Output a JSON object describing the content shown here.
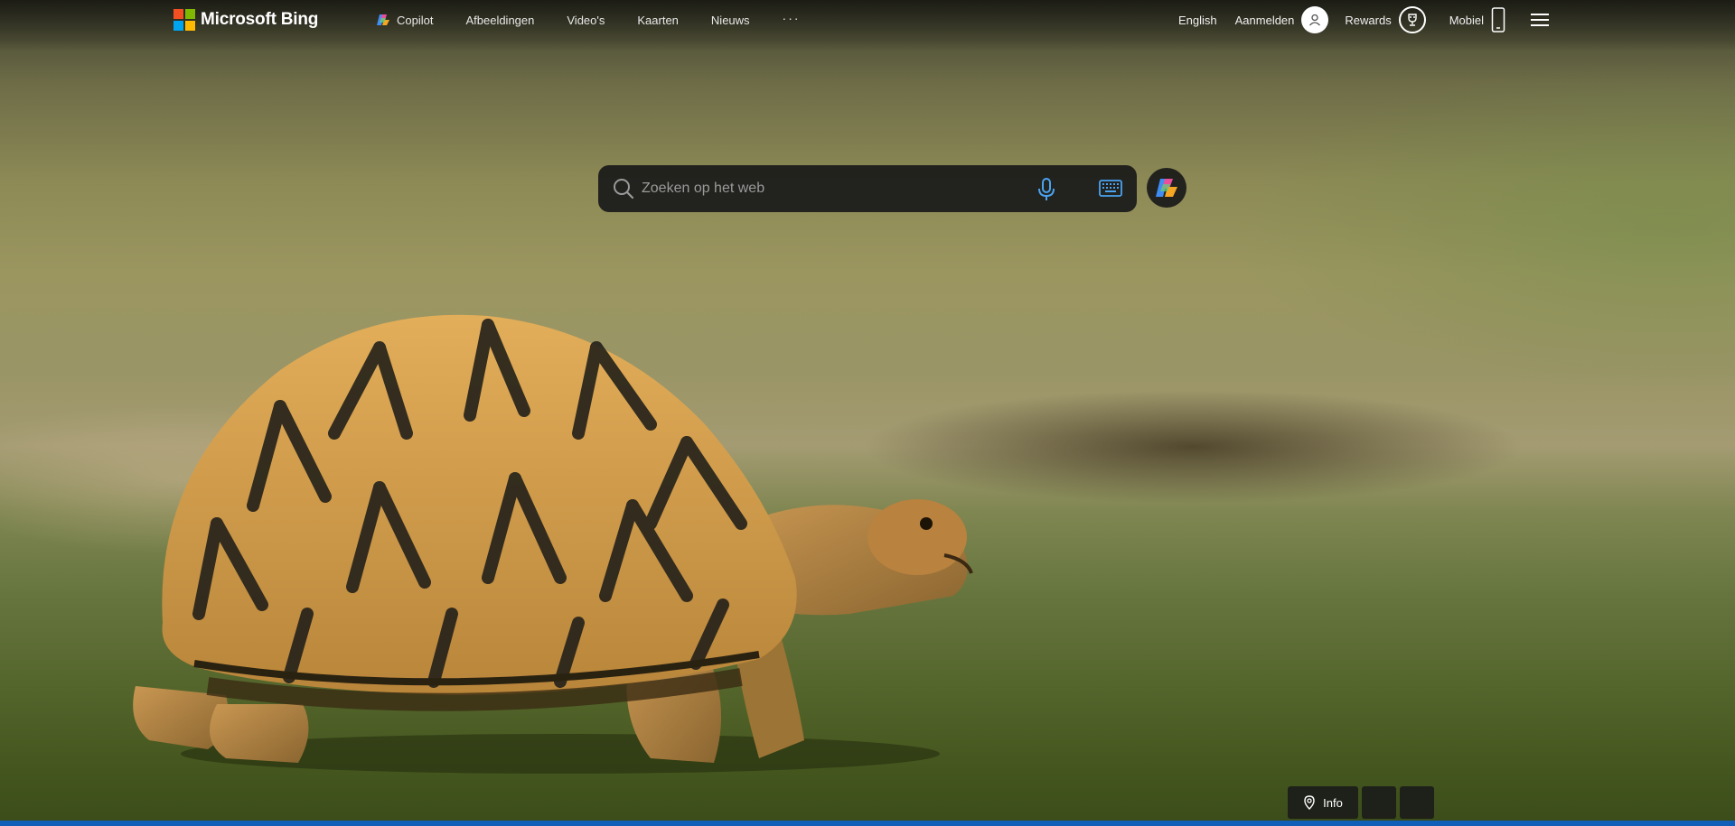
{
  "header": {
    "logo_text": "Microsoft Bing",
    "nav": [
      {
        "label": "Copilot"
      },
      {
        "label": "Afbeeldingen"
      },
      {
        "label": "Video's"
      },
      {
        "label": "Kaarten"
      },
      {
        "label": "Nieuws"
      }
    ],
    "more_label": "···",
    "language_label": "English",
    "signin_label": "Aanmelden",
    "rewards_label": "Rewards",
    "mobile_label": "Mobiel"
  },
  "search": {
    "placeholder": "Zoeken op het web"
  },
  "bottom": {
    "info_label": "Info"
  },
  "colors": {
    "accent_bar": "#0f5fb8",
    "search_bg": "#191919",
    "logo_red": "#f25022",
    "logo_green": "#7fba00",
    "logo_blue": "#00a4ef",
    "logo_yellow": "#ffb900"
  },
  "icons": [
    "microsoft-logo-icon",
    "copilot-icon",
    "user-icon",
    "rewards-trophy-icon",
    "phone-icon",
    "hamburger-menu-icon",
    "search-icon",
    "microphone-icon",
    "keyboard-icon",
    "location-pin-icon"
  ]
}
